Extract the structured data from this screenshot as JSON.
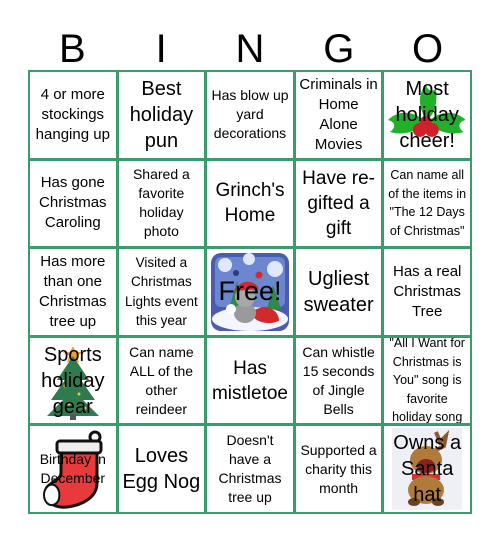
{
  "header": {
    "letters": [
      "B",
      "I",
      "N",
      "G",
      "O"
    ]
  },
  "theme": {
    "grid_color": "#3a9b6c",
    "text_color": "#000000"
  },
  "cells": [
    {
      "text": "4 or more stockings hanging up"
    },
    {
      "text": "Best holiday pun"
    },
    {
      "text": "Has blow up yard decorations"
    },
    {
      "text": "Criminals in Home Alone Movies"
    },
    {
      "text": "Most holiday cheer!",
      "icon": "holly-icon"
    },
    {
      "text": "Has gone Christmas Caroling"
    },
    {
      "text": "Shared a favorite holiday photo"
    },
    {
      "text": "Grinch's Home"
    },
    {
      "text": "Have re-gifted a gift"
    },
    {
      "text": "Can name all of the items in \"The 12 Days of Christmas\""
    },
    {
      "text": "Has more than one Christmas tree up"
    },
    {
      "text": "Visited a Christmas Lights event this year"
    },
    {
      "text": "Free!",
      "icon": "winter-kitten-icon",
      "free": true
    },
    {
      "text": "Ugliest sweater"
    },
    {
      "text": "Has a real Christmas Tree"
    },
    {
      "text": "Sports holiday gear",
      "icon": "christmas-tree-icon"
    },
    {
      "text": "Can name ALL of the other reindeer"
    },
    {
      "text": "Has mistletoe"
    },
    {
      "text": "Can whistle 15 seconds of Jingle Bells"
    },
    {
      "text": "\"All I Want for Christmas is You\" song is favorite holiday song"
    },
    {
      "text": "Birthday in December",
      "icon": "stocking-icon"
    },
    {
      "text": "Loves Egg Nog"
    },
    {
      "text": "Doesn't have a Christmas tree up"
    },
    {
      "text": "Supported a charity this month"
    },
    {
      "text": "Owns a Santa hat",
      "icon": "reindeer-icon"
    }
  ]
}
